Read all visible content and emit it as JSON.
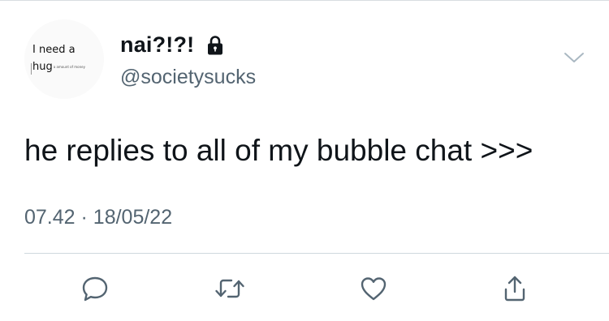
{
  "tweet": {
    "avatar": {
      "line1": "I need a",
      "line2": "hug",
      "fine_print": "a amount of money"
    },
    "display_name": "nai?!?!",
    "protected_icon": "lock-icon",
    "handle": "@societysucks",
    "menu_icon": "chevron-down-icon",
    "text": "he replies to all of my bubble chat >>>",
    "time": "07.42",
    "separator": "·",
    "date": "18/05/22",
    "actions": [
      {
        "name": "reply",
        "icon": "speech-bubble-icon"
      },
      {
        "name": "retweet",
        "icon": "retweet-icon"
      },
      {
        "name": "like",
        "icon": "heart-icon"
      },
      {
        "name": "share",
        "icon": "share-icon"
      }
    ]
  },
  "colors": {
    "text": "#0f1419",
    "secondary": "#536471",
    "divider": "#cfd9de",
    "icon": "#536471"
  }
}
